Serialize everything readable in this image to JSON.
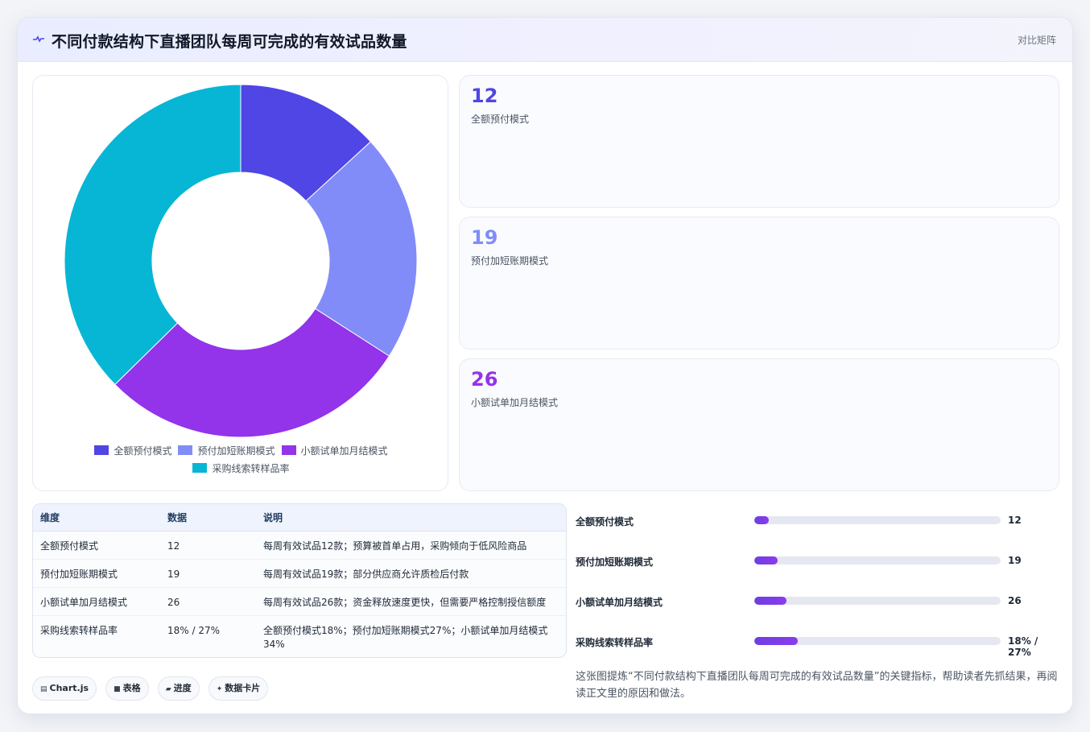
{
  "header": {
    "title": "不同付款结构下直播团队每周可完成的有效试品数量",
    "tag": "对比矩阵"
  },
  "chart_data": {
    "type": "pie",
    "donut": true,
    "categories": [
      "全额预付模式",
      "预付加短账期模式",
      "小额试单加月结模式",
      "采购线索转样品率"
    ],
    "values": [
      12,
      19,
      26,
      34
    ],
    "colors": [
      "#4f46e5",
      "#818cf8",
      "#9333ea",
      "#06b6d4"
    ],
    "legend_position": "bottom"
  },
  "stats": [
    {
      "value": "12",
      "label": "全额预付模式",
      "color": "#4f46e5"
    },
    {
      "value": "19",
      "label": "预付加短账期模式",
      "color": "#818cf8"
    },
    {
      "value": "26",
      "label": "小额试单加月结模式",
      "color": "#9333ea"
    }
  ],
  "table": {
    "headers": [
      "维度",
      "数据",
      "说明"
    ],
    "rows": [
      [
        "全额预付模式",
        "12",
        "每周有效试品12款；预算被首单占用，采购倾向于低风险商品"
      ],
      [
        "预付加短账期模式",
        "19",
        "每周有效试品19款；部分供应商允许质检后付款"
      ],
      [
        "小额试单加月结模式",
        "26",
        "每周有效试品26款；资金释放速度更快，但需要严格控制授信额度"
      ],
      [
        "采购线索转样品率",
        "18% / 27%",
        "全额预付模式18%；预付加短账期模式27%；小额试单加月结模式34%"
      ]
    ]
  },
  "progress": [
    {
      "label": "全额预付模式",
      "value": "12",
      "fraction": 0.06
    },
    {
      "label": "预付加短账期模式",
      "value": "19",
      "fraction": 0.095
    },
    {
      "label": "小额试单加月结模式",
      "value": "26",
      "fraction": 0.13
    },
    {
      "label": "采购线索转样品率",
      "value": "18% / 27%",
      "fraction": 0.175
    }
  ],
  "note": "这张图提炼“不同付款结构下直播团队每周可完成的有效试品数量”的关键指标，帮助读者先抓结果，再阅读正文里的原因和做法。",
  "chips": [
    {
      "icon": "chart-icon",
      "glyph": "▤",
      "label": "Chart.js"
    },
    {
      "icon": "table-icon",
      "glyph": "■",
      "label": "表格"
    },
    {
      "icon": "progress-icon",
      "glyph": "▰",
      "label": "进度"
    },
    {
      "icon": "sparkle-icon",
      "glyph": "✦",
      "label": "数据卡片"
    }
  ]
}
